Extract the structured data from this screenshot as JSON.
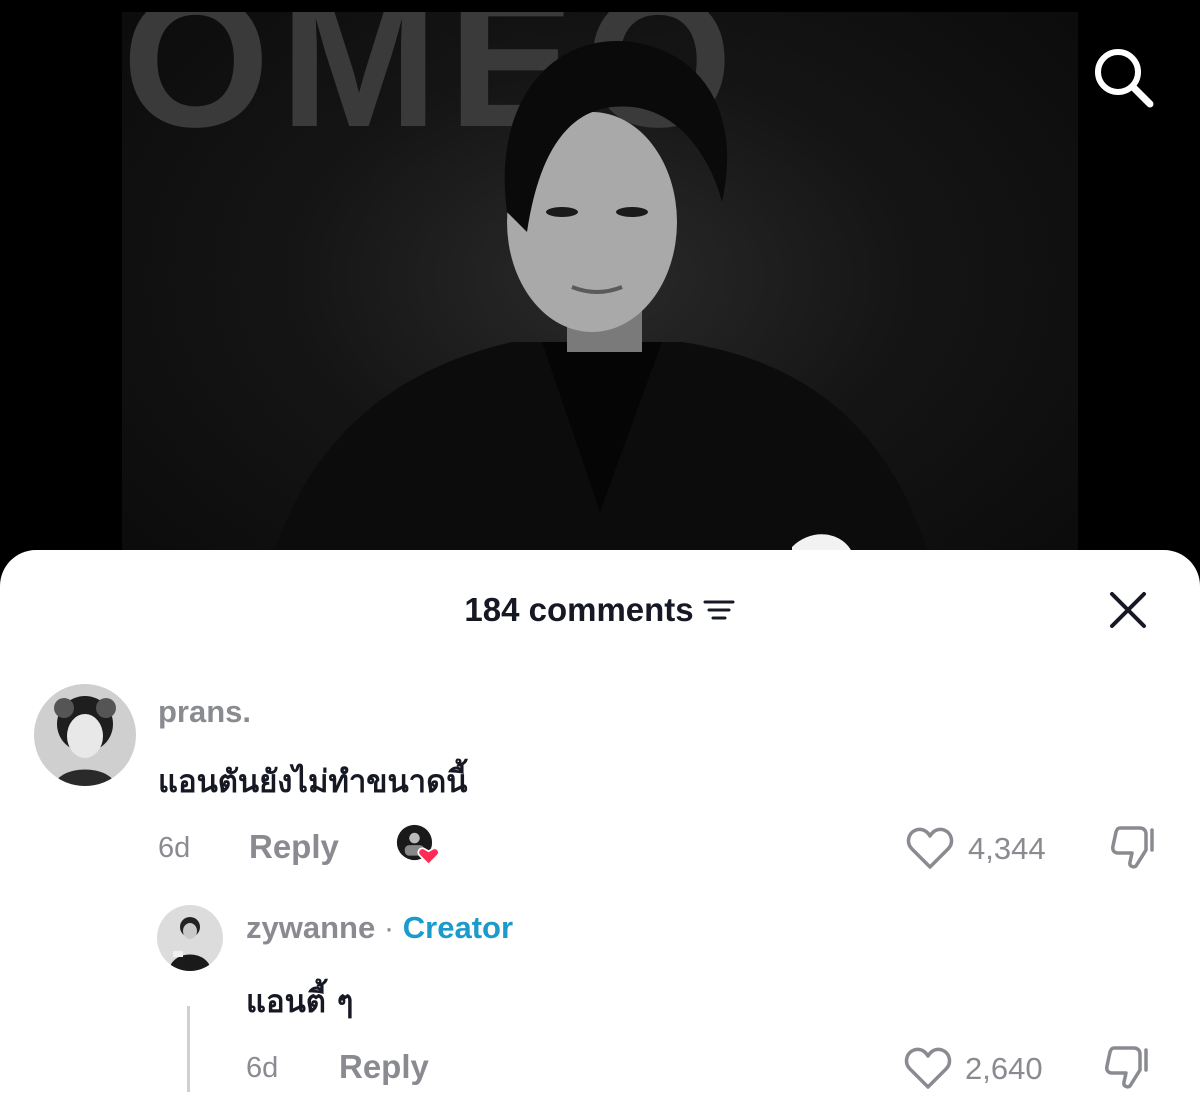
{
  "video": {
    "background_text": "OMEO"
  },
  "comments_sheet": {
    "count_label": "184 comments"
  },
  "comments": [
    {
      "username": "prans.",
      "text": "แอนตันยังไม่ทำขนาดนี้",
      "time": "6d",
      "reply_label": "Reply",
      "likes": "4,344"
    }
  ],
  "replies": [
    {
      "username": "zywanne",
      "separator": "·",
      "badge": "Creator",
      "text": "แอนตี้ ๆ",
      "time": "6d",
      "reply_label": "Reply",
      "likes": "2,640"
    }
  ],
  "colors": {
    "accent_creator": "#1a9bc9",
    "heart_badge": "#fe2c55",
    "muted": "#8a8b91",
    "text": "#161823"
  }
}
